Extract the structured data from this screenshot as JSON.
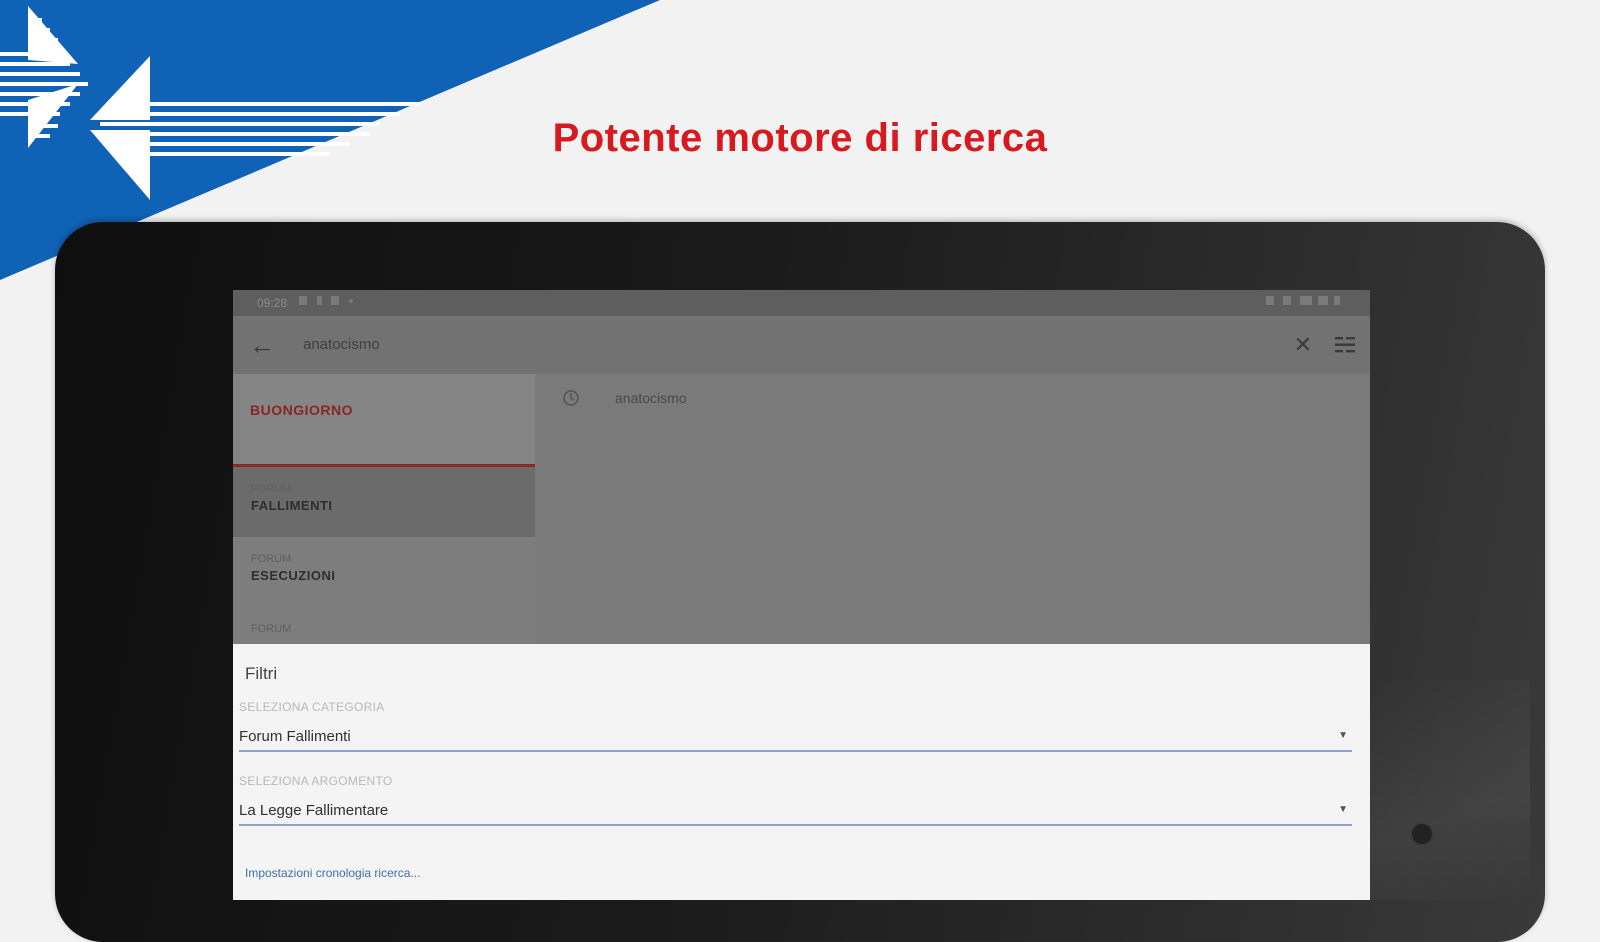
{
  "promo": {
    "headline": "Potente motore di ricerca",
    "headline_color": "#d71920",
    "brand_blue": "#0f62b5"
  },
  "statusbar": {
    "time": "09:28",
    "icons": [
      "image-icon",
      "download-icon",
      "wrench-icon",
      "dot-icon",
      "mute-icon",
      "vibrate-icon",
      "wifi-icon",
      "signal-icon",
      "battery-icon"
    ]
  },
  "toolbar": {
    "back_icon": "arrow-left-icon",
    "query": "anatocismo",
    "clear_icon": "close-icon",
    "filter_icon": "filter-list-icon"
  },
  "sidebar": {
    "greeting": "BUONGIORNO",
    "items": [
      {
        "category": "FORUM",
        "label": "FALLIMENTI",
        "active": true
      },
      {
        "category": "FORUM",
        "label": "ESECUZIONI",
        "active": false
      },
      {
        "category": "FORUM",
        "label": "",
        "active": false
      }
    ]
  },
  "results": {
    "history_icon": "history-icon",
    "items": [
      "anatocismo"
    ]
  },
  "filters": {
    "title": "Filtri",
    "category_label": "SELEZIONA CATEGORIA",
    "category_value": "Forum Fallimenti",
    "topic_label": "SELEZIONA ARGOMENTO",
    "topic_value": "La Legge Fallimentare",
    "settings_link": "Impostazioni cronologia ricerca..."
  }
}
